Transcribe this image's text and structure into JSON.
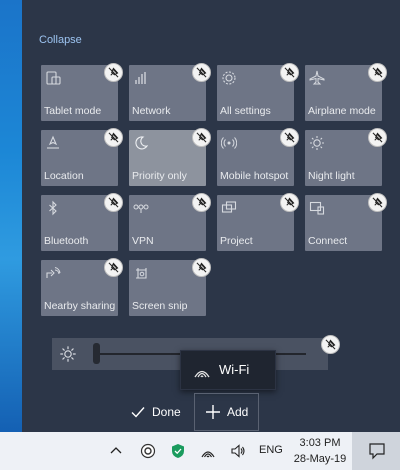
{
  "panel": {
    "collapse_label": "Collapse"
  },
  "tiles": [
    {
      "label": "Tablet mode",
      "icon": "tablet-mode-icon",
      "active": false
    },
    {
      "label": "Network",
      "icon": "network-icon",
      "active": false
    },
    {
      "label": "All settings",
      "icon": "settings-gear-icon",
      "active": false
    },
    {
      "label": "Airplane mode",
      "icon": "airplane-icon",
      "active": false
    },
    {
      "label": "Location",
      "icon": "location-icon",
      "active": false
    },
    {
      "label": "Priority only",
      "icon": "moon-icon",
      "active": true
    },
    {
      "label": "Mobile hotspot",
      "icon": "hotspot-icon",
      "active": false
    },
    {
      "label": "Night light",
      "icon": "night-light-icon",
      "active": false
    },
    {
      "label": "Bluetooth",
      "icon": "bluetooth-icon",
      "active": false
    },
    {
      "label": "VPN",
      "icon": "vpn-icon",
      "active": false
    },
    {
      "label": "Project",
      "icon": "project-icon",
      "active": false
    },
    {
      "label": "Connect",
      "icon": "connect-icon",
      "active": false
    },
    {
      "label": "Nearby sharing",
      "icon": "nearby-sharing-icon",
      "active": false
    },
    {
      "label": "Screen snip",
      "icon": "screen-snip-icon",
      "active": false
    }
  ],
  "brightness": {
    "level_fraction": 0.0,
    "icon": "brightness-sun-icon"
  },
  "drag_tile": {
    "label": "Wi-Fi",
    "icon": "wifi-icon"
  },
  "edit_buttons": {
    "done_label": "Done",
    "add_label": "Add"
  },
  "taskbar": {
    "language": "ENG",
    "time": "3:03 PM",
    "date": "28-May-19"
  },
  "colors": {
    "panel_bg": "#2c3648",
    "tile_bg": "#6e7586",
    "tile_active_bg": "#8d939e",
    "taskbar_bg": "#eef1f6",
    "accent_link": "#9cc3f0"
  }
}
